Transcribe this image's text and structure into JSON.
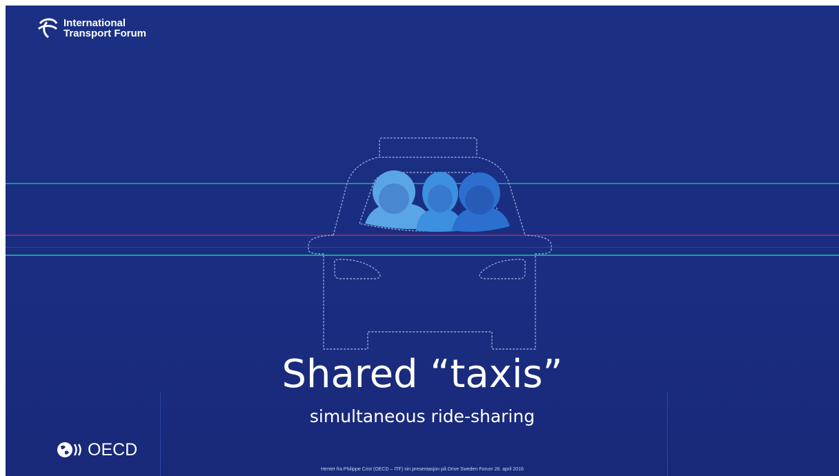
{
  "logo": {
    "line1": "International",
    "line2": "Transport Forum",
    "icon": "itf-logo-icon"
  },
  "title": "Shared “taxis”",
  "subtitle": "simultaneous ride-sharing",
  "oecd_logo": {
    "text": "OECD",
    "icon": "oecd-globe-icon"
  },
  "footer": "Hentet fra Philippe Crist (OECD – ITF) sin presentasjon på Drive Sweden Forum 28. april 2016",
  "colors": {
    "background": "#1a2d80",
    "car_outline": "#8ea3d8",
    "passenger_left": "#5aa5e6",
    "passenger_middle": "#3d8fe0",
    "passenger_right": "#2c6fcf"
  }
}
